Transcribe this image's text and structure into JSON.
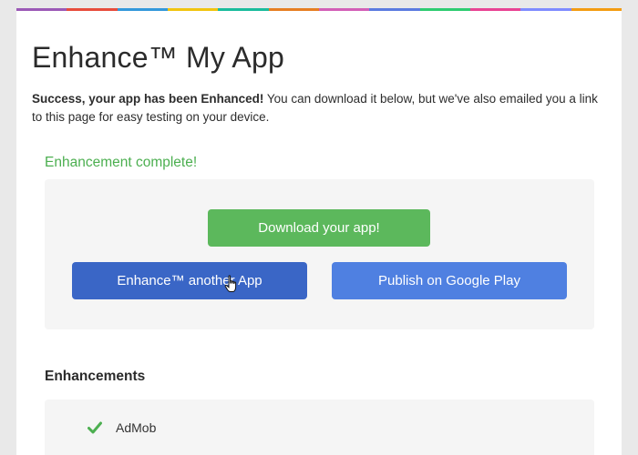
{
  "header": {
    "rainbow_colors": [
      "#9b59b6",
      "#e74c3c",
      "#3498db",
      "#f1c40f",
      "#1abc9c",
      "#e67e22",
      "#d35fb7",
      "#5b7be0",
      "#2ecc71",
      "#e84393",
      "#7f8cff",
      "#f39c12"
    ],
    "title": "Enhance™ My App"
  },
  "intro": {
    "bold": "Success, your app has been Enhanced!",
    "rest": " You can download it below, but we've also emailed you a link to this page for easy testing on your device."
  },
  "status": {
    "text": "Enhancement complete!",
    "color": "#4caf50"
  },
  "actions": {
    "download_label": "Download your app!",
    "enhance_another_label": "Enhance™ another App",
    "publish_label": "Publish on Google Play"
  },
  "enhancements": {
    "title": "Enhancements",
    "items": [
      {
        "label": "AdMob",
        "icon": "check-icon"
      }
    ]
  }
}
